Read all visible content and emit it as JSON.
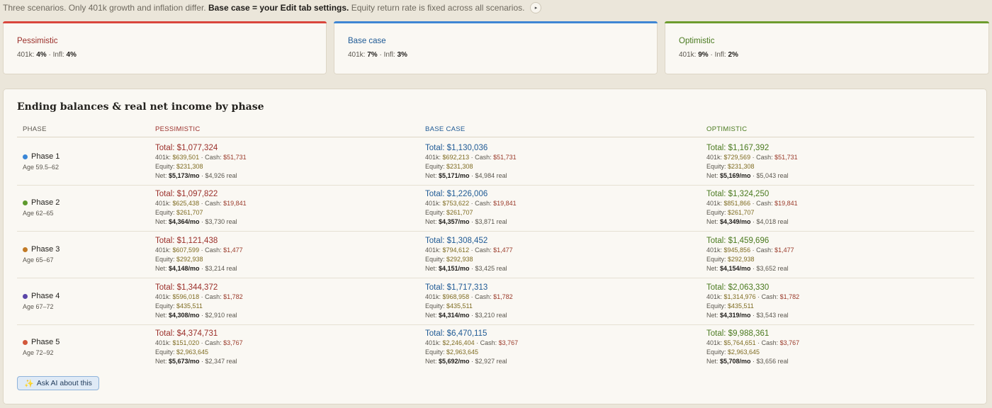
{
  "intro": {
    "text_before": "Three scenarios. Only 401k growth and inflation differ.",
    "bold": "Base case = your Edit tab settings.",
    "text_after": "Equity return rate is fixed across all scenarios.",
    "play_icon": "▸"
  },
  "scenarios": [
    {
      "name": "Pessimistic",
      "rates_prefix": "401k:",
      "growth": "4%",
      "mid": "· Infl:",
      "infl": "4%",
      "color": "#9b2f2a",
      "bar": "#d9463c"
    },
    {
      "name": "Base case",
      "rates_prefix": "401k:",
      "growth": "7%",
      "mid": "· Infl:",
      "infl": "3%",
      "color": "#1f5a95",
      "bar": "#3f86d4"
    },
    {
      "name": "Optimistic",
      "rates_prefix": "401k:",
      "growth": "9%",
      "mid": "· Infl:",
      "infl": "2%",
      "color": "#4a7a1f",
      "bar": "#6d9c2e"
    }
  ],
  "table": {
    "title": "Ending balances & real net income by phase",
    "headers": [
      "Phase",
      "Pessimistic",
      "Base case",
      "Optimistic"
    ],
    "rows": [
      {
        "phase": "Phase 1",
        "age": "Age 59.5–62",
        "dot": "#3a86d6",
        "cells": [
          {
            "total": "Total: $1,077,324",
            "k401": "$639,501",
            "cash": "$51,731",
            "equity": "$231,308",
            "net": "$5,173/mo",
            "real": "$4,926 real"
          },
          {
            "total": "Total: $1,130,036",
            "k401": "$692,213",
            "cash": "$51,731",
            "equity": "$231,308",
            "net": "$5,171/mo",
            "real": "$4,984 real"
          },
          {
            "total": "Total: $1,167,392",
            "k401": "$729,569",
            "cash": "$51,731",
            "equity": "$231,308",
            "net": "$5,169/mo",
            "real": "$5,043 real"
          }
        ]
      },
      {
        "phase": "Phase 2",
        "age": "Age 62–65",
        "dot": "#5e9a2c",
        "cells": [
          {
            "total": "Total: $1,097,822",
            "k401": "$625,438",
            "cash": "$19,841",
            "equity": "$261,707",
            "net": "$4,364/mo",
            "real": "$3,730 real"
          },
          {
            "total": "Total: $1,226,006",
            "k401": "$753,622",
            "cash": "$19,841",
            "equity": "$261,707",
            "net": "$4,357/mo",
            "real": "$3,871 real"
          },
          {
            "total": "Total: $1,324,250",
            "k401": "$851,866",
            "cash": "$19,841",
            "equity": "$261,707",
            "net": "$4,349/mo",
            "real": "$4,018 real"
          }
        ]
      },
      {
        "phase": "Phase 3",
        "age": "Age 65–67",
        "dot": "#c27a25",
        "cells": [
          {
            "total": "Total: $1,121,438",
            "k401": "$607,599",
            "cash": "$1,477",
            "equity": "$292,938",
            "net": "$4,148/mo",
            "real": "$3,214 real"
          },
          {
            "total": "Total: $1,308,452",
            "k401": "$794,612",
            "cash": "$1,477",
            "equity": "$292,938",
            "net": "$4,151/mo",
            "real": "$3,425 real"
          },
          {
            "total": "Total: $1,459,696",
            "k401": "$945,856",
            "cash": "$1,477",
            "equity": "$292,938",
            "net": "$4,154/mo",
            "real": "$3,652 real"
          }
        ]
      },
      {
        "phase": "Phase 4",
        "age": "Age 67–72",
        "dot": "#5a45a8",
        "cells": [
          {
            "total": "Total: $1,344,372",
            "k401": "$596,018",
            "cash": "$1,782",
            "equity": "$435,511",
            "net": "$4,308/mo",
            "real": "$2,910 real"
          },
          {
            "total": "Total: $1,717,313",
            "k401": "$968,958",
            "cash": "$1,782",
            "equity": "$435,511",
            "net": "$4,314/mo",
            "real": "$3,210 real"
          },
          {
            "total": "Total: $2,063,330",
            "k401": "$1,314,976",
            "cash": "$1,782",
            "equity": "$435,511",
            "net": "$4,319/mo",
            "real": "$3,543 real"
          }
        ]
      },
      {
        "phase": "Phase 5",
        "age": "Age 72–92",
        "dot": "#d2573a",
        "cells": [
          {
            "total": "Total: $4,374,731",
            "k401": "$151,020",
            "cash": "$3,767",
            "equity": "$2,963,645",
            "net": "$5,673/mo",
            "real": "$2,347 real"
          },
          {
            "total": "Total: $6,470,115",
            "k401": "$2,246,404",
            "cash": "$3,767",
            "equity": "$2,963,645",
            "net": "$5,692/mo",
            "real": "$2,927 real"
          },
          {
            "total": "Total: $9,988,361",
            "k401": "$5,764,651",
            "cash": "$3,767",
            "equity": "$2,963,645",
            "net": "$5,708/mo",
            "real": "$3,656 real"
          }
        ]
      }
    ],
    "labels": {
      "k401": "401k: ",
      "cash": " · Cash: ",
      "equity": "Equity: ",
      "net": "Net: ",
      "sep": " · "
    }
  },
  "ai_button": {
    "icon": "✨",
    "label": "Ask AI about this"
  }
}
